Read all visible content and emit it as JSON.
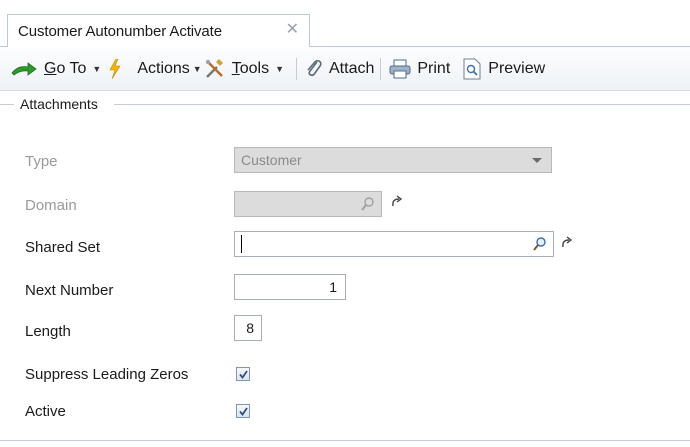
{
  "tab": {
    "title": "Customer Autonumber Activate",
    "close_glyph": "✕"
  },
  "toolbar": {
    "goto_label": "Go To",
    "goto_mnemonic": "G",
    "goto_rest": "o To",
    "actions_label": "Actions",
    "tools_mnemonic": "T",
    "tools_rest": "ools",
    "attach_label": "Attach",
    "print_label": "Print",
    "preview_label": "Preview"
  },
  "group": {
    "title": "Attachments"
  },
  "form": {
    "type": {
      "label": "Type",
      "value": "Customer",
      "disabled": true
    },
    "domain": {
      "label": "Domain",
      "value": "",
      "disabled": true
    },
    "shared_set": {
      "label": "Shared Set",
      "value": ""
    },
    "next_number": {
      "label": "Next Number",
      "value": "1"
    },
    "length": {
      "label": "Length",
      "value": "8"
    },
    "suppress_leading_zeros": {
      "label": "Suppress Leading Zeros",
      "checked": true
    },
    "active": {
      "label": "Active",
      "checked": true
    }
  },
  "icons": {
    "goto": "green-arrow-icon",
    "actions": "lightning-icon",
    "tools": "tools-icon",
    "attach": "paperclip-icon",
    "print": "printer-icon",
    "preview": "preview-icon",
    "lookup": "magnifier-icon",
    "link": "link-arrow-icon",
    "check": "checkmark-icon"
  },
  "colors": {
    "accent": "#4a7ab5",
    "border": "#b9c9dc",
    "disabled_bg": "#dcdcdc"
  }
}
